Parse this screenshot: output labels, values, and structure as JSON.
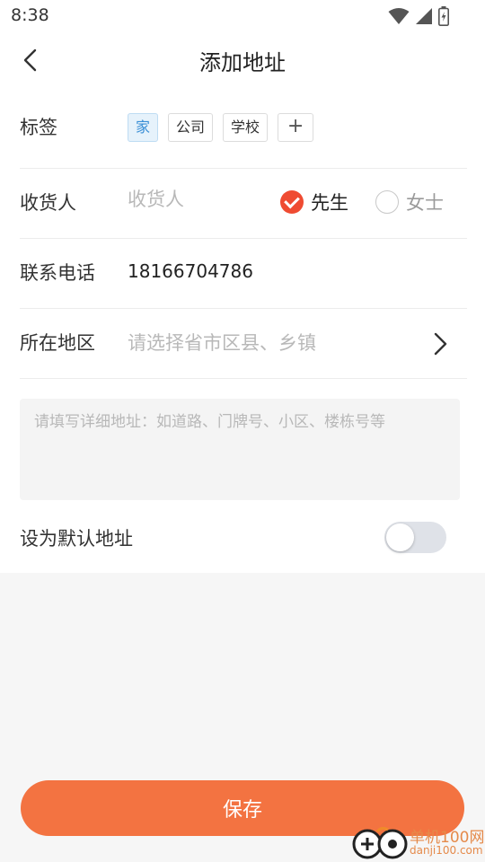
{
  "status_bar": {
    "time": "8:38"
  },
  "nav": {
    "title": "添加地址"
  },
  "form": {
    "tag_label": "标签",
    "tags": [
      "家",
      "公司",
      "学校"
    ],
    "tag_add": "+",
    "receiver_label": "收货人",
    "receiver_placeholder": "收货人",
    "receiver_value": "",
    "gender_male": "先生",
    "gender_female": "女士",
    "gender_selected": "先生",
    "phone_label": "联系电话",
    "phone_value": "18166704786",
    "region_label": "所在地区",
    "region_placeholder": "请选择省市区县、乡镇",
    "detail_placeholder": "请填写详细地址：如道路、门牌号、小区、楼栋号等",
    "default_label": "设为默认地址",
    "default_on": false
  },
  "save_label": "保存",
  "watermark": {
    "name": "单机100网",
    "url": "danji100.com"
  },
  "colors": {
    "accent": "#f37341",
    "radio_checked": "#ef4b32",
    "tag_active_text": "#3a8fd6",
    "tag_active_bg": "#e6f2fb",
    "switch_off": "#dfe2e8"
  }
}
